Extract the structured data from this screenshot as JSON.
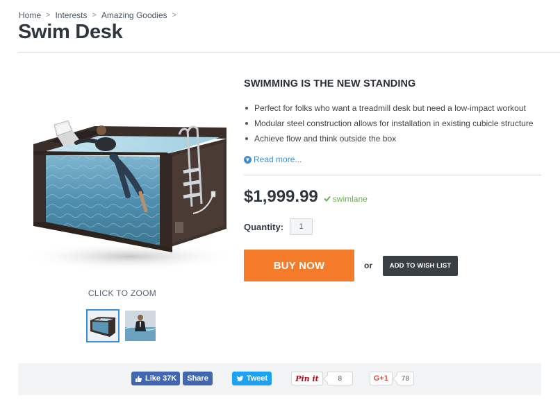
{
  "breadcrumb": {
    "items": [
      "Home",
      "Interests",
      "Amazing Goodies"
    ],
    "separator": ">"
  },
  "page": {
    "title": "Swim Desk"
  },
  "gallery": {
    "zoom_label": "CLICK TO ZOOM",
    "thumbnails": [
      "swim-desk-tank",
      "man-in-suit-in-water"
    ],
    "active_thumbnail": 0
  },
  "product": {
    "tagline": "SWIMMING IS THE NEW STANDING",
    "features": [
      "Perfect for folks who want a treadmill desk but need a low-impact workout",
      "Modular steel construction allows for installation in existing cubicle structure",
      "Achieve flow and think outside the box"
    ],
    "read_more": "Read more...",
    "price": "$1,999.99",
    "stock_label": "swimlane",
    "quantity_label": "Quantity:",
    "quantity_value": "1",
    "buy_label": "BUY NOW",
    "or_label": "or",
    "wishlist_label": "ADD TO WISH LIST"
  },
  "share": {
    "fb_like": "Like 37K",
    "fb_share": "Share",
    "tweet": "Tweet",
    "pin": "Pin it",
    "pin_count": "8",
    "gplus": "G+1",
    "gplus_count": "78"
  },
  "colors": {
    "accent_blue": "#3a8ed4",
    "buy_orange": "#f47b2a",
    "wishlist_dark": "#3a3f44",
    "stock_green": "#6ab04c",
    "facebook": "#4267b2",
    "twitter": "#1da1f2",
    "pinterest": "#bd081c",
    "gplus": "#dd4b39"
  },
  "icons": [
    "chevron-right-icon",
    "info-circle-icon",
    "checkmark-icon",
    "thumbs-up-icon",
    "twitter-bird-icon"
  ]
}
